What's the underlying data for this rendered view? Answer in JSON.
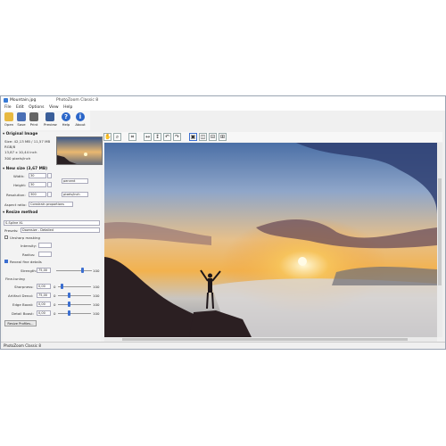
{
  "window": {
    "file_name": "Mountain.jpg",
    "app_title": "PhotoZoom Classic 8"
  },
  "menu": [
    "File",
    "Edit",
    "Options",
    "View",
    "Help"
  ],
  "toolbar": [
    {
      "label": "Open",
      "icon": "folder-icon"
    },
    {
      "label": "Save",
      "icon": "save-icon"
    },
    {
      "label": "Print",
      "icon": "print-icon"
    },
    {
      "label": "Preview",
      "icon": "preview-icon"
    },
    {
      "label": "Help",
      "icon": "help-icon"
    },
    {
      "label": "About",
      "icon": "info-icon"
    }
  ],
  "original_image": {
    "header": "Original Image",
    "size": "Size: 42,13 MB / 11,57 MB",
    "mode": "RGB/8",
    "dimensions": "13,87 x 10,44 inch",
    "resolution": "300 pixels/inch"
  },
  "new_size": {
    "header": "New size (3,67 MB)",
    "width_label": "Width:",
    "width_value": "30",
    "height_label": "Height:",
    "height_value": "30",
    "unit": "percent",
    "resolution_label": "Resolution:",
    "resolution_value": "300",
    "resolution_unit": "pixels/inch",
    "aspect_label": "Aspect ratio:",
    "aspect_value": "Constrain proportions"
  },
  "resize_method": {
    "header": "Resize method",
    "method": "S-Spline XL",
    "presets_label": "Presets:",
    "presets_value": "Downsize - Detailed",
    "unsharp_label": "Unsharp masking",
    "intensity_label": "Intensity:",
    "radius_label": "Radius:",
    "reveal_label": "Reveal fine details",
    "strength_label": "Strength:",
    "strength_value": "75,00",
    "strength_max": "100",
    "finetuning_label": "Fine-tuning",
    "sharpness_label": "Sharpness:",
    "sharpness_value": "0,00",
    "artifact_label": "Artifact Denoi:",
    "artifact_value": "75,00",
    "edgeboost_label": "Edge Boost:",
    "edgeboost_value": "0,00",
    "detailboost_label": "Detail Boost:",
    "detailboost_value": "0,00",
    "zero": "0",
    "hundred": "100",
    "resize_profiles": "Resize Profiles..."
  },
  "status": "PhotoZoom Classic 8",
  "colors": {
    "accent": "#3b6ed0",
    "window_bg": "#f0f0f0"
  }
}
